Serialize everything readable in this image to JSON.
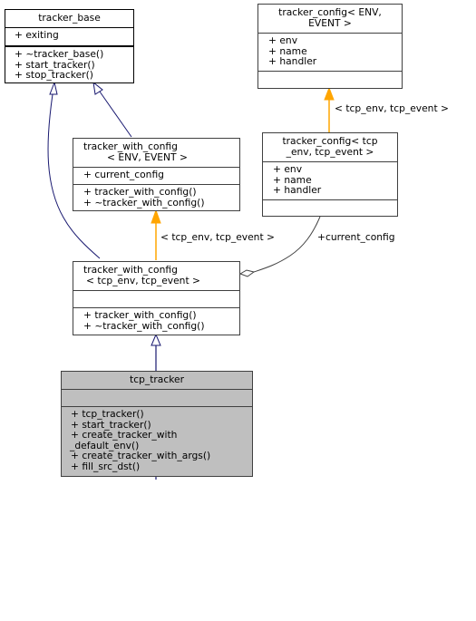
{
  "diagram": {
    "type": "uml-class-inheritance",
    "classes": {
      "tracker_base": {
        "title": "tracker_base",
        "attributes": [
          "+ exiting"
        ],
        "methods": [
          "+ ~tracker_base()",
          "+ start_tracker()",
          "+ stop_tracker()"
        ]
      },
      "tracker_config_template": {
        "title_lines": [
          "tracker_config< ENV,",
          "EVENT >"
        ],
        "attributes": [
          "+ env",
          "+ name",
          "+ handler"
        ],
        "methods": []
      },
      "tracker_with_config_template": {
        "title_lines": [
          "tracker_with_config",
          "< ENV, EVENT >"
        ],
        "attributes": [
          "+ current_config"
        ],
        "methods": [
          "+ tracker_with_config()",
          "+ ~tracker_with_config()"
        ]
      },
      "tracker_config_tcp": {
        "title_lines": [
          "tracker_config< tcp",
          "_env, tcp_event >"
        ],
        "attributes": [
          "+ env",
          "+ name",
          "+ handler"
        ],
        "methods": []
      },
      "tracker_with_config_tcp": {
        "title_lines": [
          "tracker_with_config",
          "< tcp_env, tcp_event >"
        ],
        "attributes": [],
        "methods": [
          "+ tracker_with_config()",
          "+ ~tracker_with_config()"
        ]
      },
      "tcp_tracker": {
        "title": "tcp_tracker",
        "attributes": [],
        "methods": [
          "+ tcp_tracker()",
          "+ start_tracker()",
          "+ create_tracker_with",
          "_default_env()",
          "+ create_tracker_with_args()",
          "+ fill_src_dst()"
        ]
      }
    },
    "edge_labels": {
      "config_template_binding": "< tcp_env, tcp_event >",
      "with_config_template_binding": "< tcp_env, tcp_event >",
      "aggregation_role": "+current_config"
    },
    "colors": {
      "inheritance": "#191970",
      "template_binding": "#ffa500",
      "aggregation": "#404040",
      "highlight_fill": "#bfbfbf"
    }
  }
}
